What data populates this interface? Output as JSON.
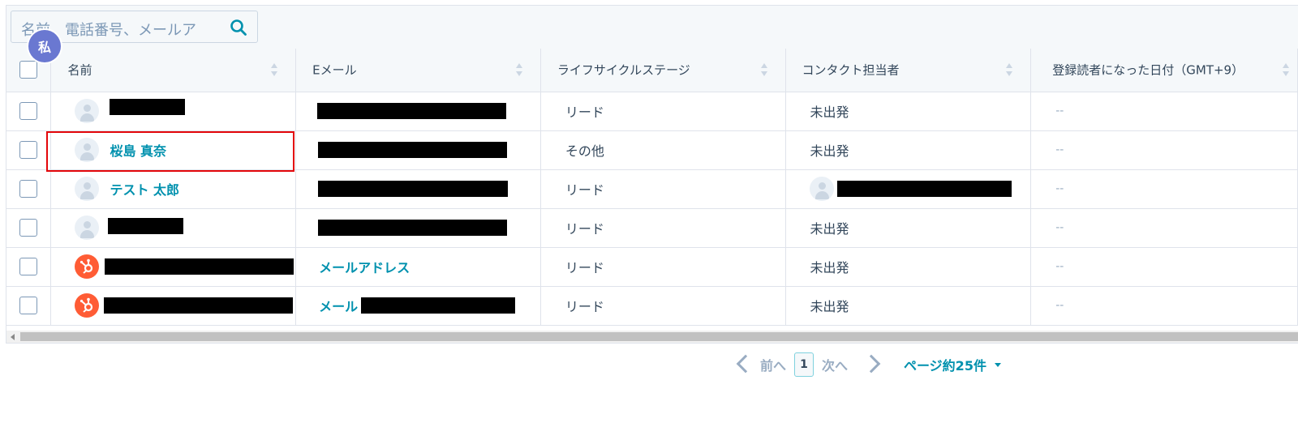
{
  "search": {
    "placeholder": "名前、電話番号、メールア",
    "icon": "search-icon"
  },
  "me_avatar": "私",
  "columns": [
    {
      "label": "名前"
    },
    {
      "label": "Eメール"
    },
    {
      "label": "ライフサイクルステージ"
    },
    {
      "label": "コンタクト担当者"
    },
    {
      "label": "登録読者になった日付（GMT+9）"
    }
  ],
  "rows": [
    {
      "name": "",
      "email_link": "",
      "stage": "リード",
      "owner": "未出発",
      "date": "--"
    },
    {
      "name": "桜島 真奈",
      "email_link": "",
      "stage": "その他",
      "owner": "未出発",
      "date": "--"
    },
    {
      "name": "テスト 太郎",
      "email_link": "",
      "stage": "リード",
      "owner": "",
      "date": "--"
    },
    {
      "name": "",
      "email_link": "",
      "stage": "リード",
      "owner": "未出発",
      "date": "--"
    },
    {
      "name": "",
      "email_link": "メールアドレス",
      "stage": "リード",
      "owner": "未出発",
      "date": "--"
    },
    {
      "name": "",
      "email_link": "メール",
      "stage": "リード",
      "owner": "未出発",
      "date": "--"
    }
  ],
  "pagination": {
    "prev": "前へ",
    "current": "1",
    "next": "次へ",
    "per_page": "ページ約25件"
  },
  "colors": {
    "link": "#0091ae",
    "highlight": "#e3060a",
    "hubspot_orange": "#ff5c35",
    "avatar_me": "#6a78d1"
  }
}
